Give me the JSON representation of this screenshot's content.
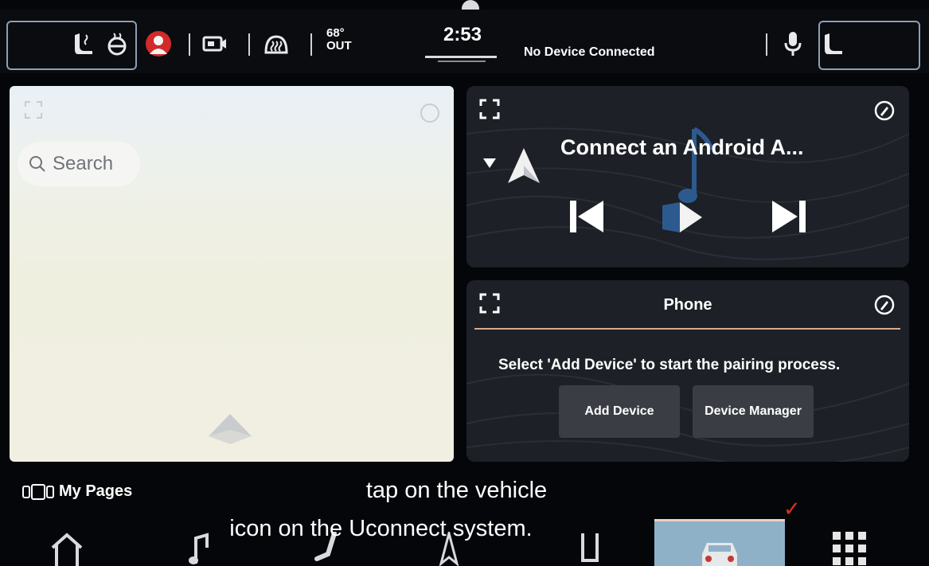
{
  "status_bar": {
    "temperature": "68°",
    "temperature_unit": "OUT",
    "time": "2:53",
    "connection_status": "No Device Connected",
    "icons": [
      "heated-seat-icon",
      "steering-wheel-heat-icon",
      "driver-profile-icon",
      "camera-icon",
      "defrost-icon",
      "microphone-icon",
      "passenger-seat-icon"
    ]
  },
  "map_widget": {
    "search_placeholder": "Search"
  },
  "media_widget": {
    "title": "Connect an Android A...",
    "controls": [
      "previous-track-icon",
      "play-icon",
      "next-track-icon"
    ]
  },
  "phone_widget": {
    "title": "Phone",
    "message": "Select 'Add Device' to start the pairing process.",
    "add_device_label": "Add Device",
    "device_manager_label": "Device Manager"
  },
  "my_pages": {
    "label": "My Pages"
  },
  "caption": {
    "line1": "tap on the vehicle",
    "line2": "icon on the Uconnect system."
  },
  "bottom_nav": {
    "items": [
      "home-icon",
      "music-icon",
      "seat-icon",
      "navigation-icon",
      "phone-icon",
      "vehicle-icon",
      "apps-grid-icon"
    ],
    "active": "vehicle-icon"
  },
  "colors": {
    "accent_line": "#d9a98f",
    "active_tab": "#8fb1c8",
    "check_mark": "#e03020"
  }
}
